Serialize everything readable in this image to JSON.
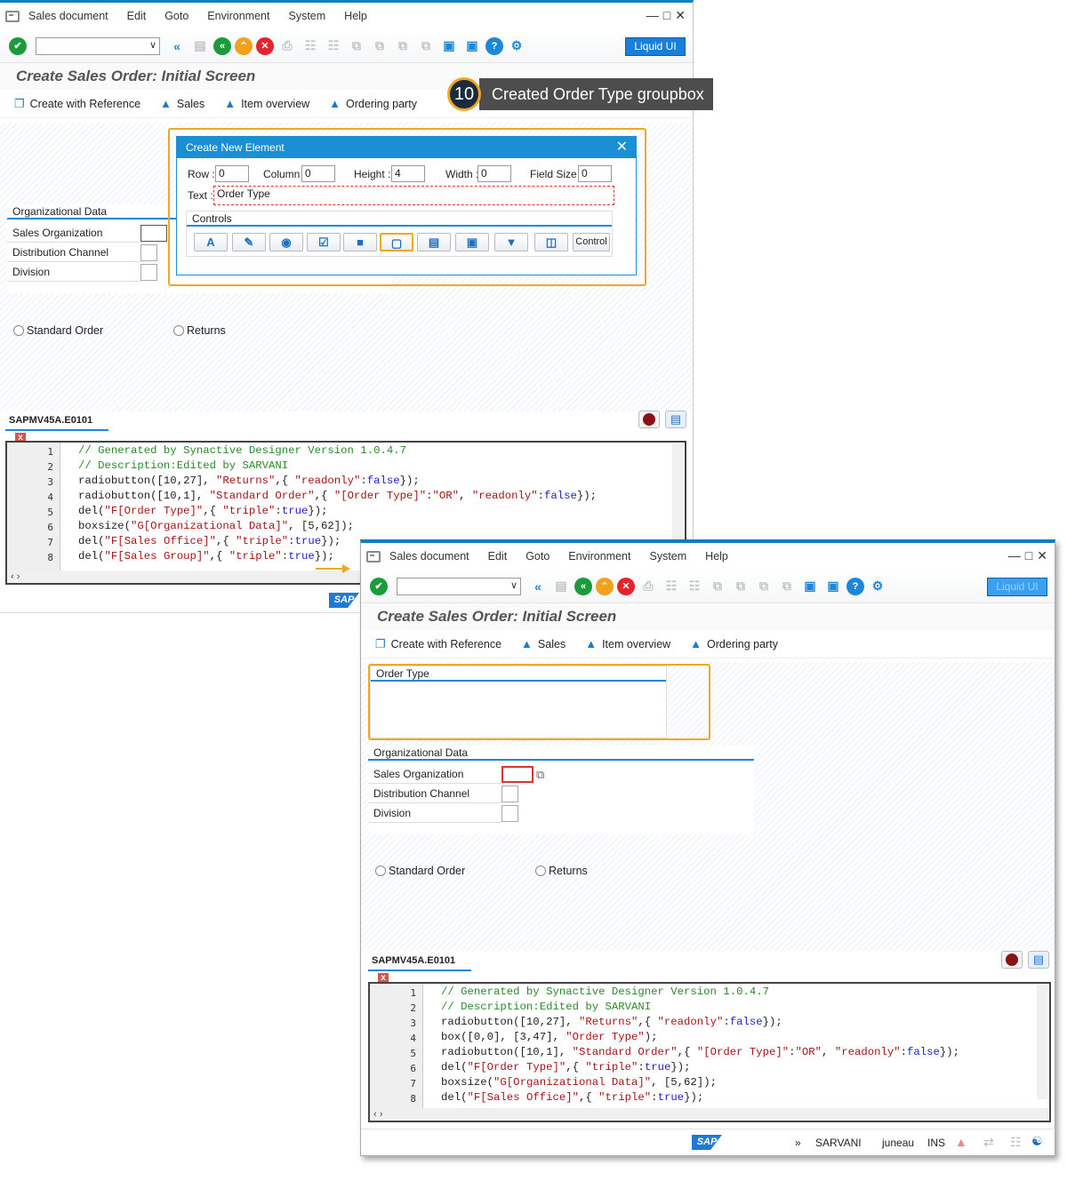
{
  "window1": {
    "menu": [
      "Sales document",
      "Edit",
      "Goto",
      "Environment",
      "System",
      "Help"
    ],
    "liquid_button": "Liquid UI",
    "page_title": "Create Sales Order: Initial Screen",
    "app_toolbar": [
      "Create with Reference",
      "Sales",
      "Item overview",
      "Ordering party"
    ],
    "org_group": {
      "title": "Organizational Data",
      "fields": [
        "Sales Organization",
        "Distribution Channel",
        "Division"
      ]
    },
    "radios": [
      "Standard Order",
      "Returns"
    ],
    "editor_tab": "SAPMV45A.E0101",
    "code": [
      "// Generated by Synactive Designer Version 1.0.4.7",
      "// Description:Edited by SARVANI",
      "radiobutton([10,27], \"Returns\",{ \"readonly\":false});",
      "radiobutton([10,1], \"Standard Order\",{ \"[Order Type]\":\"OR\", \"readonly\":false});",
      "del(\"F[Order Type]\",{ \"triple\":true});",
      "boxsize(\"G[Organizational Data]\", [5,62]);",
      "del(\"F[Sales Office]\",{ \"triple\":true});",
      "del(\"F[Sales Group]\",{ \"triple\":true});"
    ],
    "line_numbers": [
      "1",
      "2",
      "3",
      "4",
      "5",
      "6",
      "7",
      "8"
    ]
  },
  "dialog": {
    "title": "Create New Element",
    "row_label": "Row :",
    "row": "0",
    "column_label": "Column :",
    "column": "0",
    "height_label": "Height :",
    "height": "4",
    "width_label": "Width :",
    "width": "0",
    "fieldsize_label": "Field Size :",
    "fieldsize": "0",
    "text_label": "Text :",
    "text": "Order Type",
    "controls_label": "Controls",
    "control_button": "Control"
  },
  "callout": {
    "number": "10",
    "text": "Created Order Type groupbox"
  },
  "window2": {
    "menu": [
      "Sales document",
      "Edit",
      "Goto",
      "Environment",
      "System",
      "Help"
    ],
    "liquid_button": "Liquid UI",
    "page_title": "Create Sales Order: Initial Screen",
    "app_toolbar": [
      "Create with Reference",
      "Sales",
      "Item overview",
      "Ordering party"
    ],
    "order_group": {
      "title": "Order Type"
    },
    "org_group": {
      "title": "Organizational Data",
      "fields": [
        "Sales Organization",
        "Distribution Channel",
        "Division"
      ]
    },
    "radios": [
      "Standard Order",
      "Returns"
    ],
    "editor_tab": "SAPMV45A.E0101",
    "code": [
      "// Generated by Synactive Designer Version 1.0.4.7",
      "// Description:Edited by SARVANI",
      "radiobutton([10,27], \"Returns\",{ \"readonly\":false});",
      "box([0,0], [3,47], \"Order Type\");",
      "radiobutton([10,1], \"Standard Order\",{ \"[Order Type]\":\"OR\", \"readonly\":false});",
      "del(\"F[Order Type]\",{ \"triple\":true});",
      "boxsize(\"G[Organizational Data]\", [5,62]);",
      "del(\"F[Sales Office]\",{ \"triple\":true});"
    ],
    "line_numbers": [
      "1",
      "2",
      "3",
      "4",
      "5",
      "6",
      "7",
      "8"
    ],
    "status": {
      "arrows": "»",
      "system": "SARVANI",
      "client": "juneau",
      "mode": "INS"
    }
  },
  "sap_logo": "SAP",
  "colors": {
    "accent": "#1a8fd6",
    "highlight": "#f0a823",
    "callout_bg": "#4d4d4d"
  }
}
